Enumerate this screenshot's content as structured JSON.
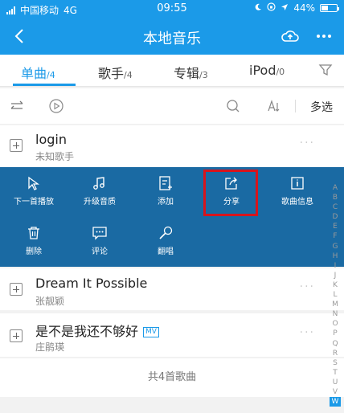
{
  "status": {
    "carrier": "中国移动",
    "network": "4G",
    "time": "09:55",
    "battery": "44%",
    "battery_level": 0.44
  },
  "nav": {
    "title": "本地音乐"
  },
  "tabs": [
    {
      "label": "单曲",
      "count": "/4"
    },
    {
      "label": "歌手",
      "count": "/4"
    },
    {
      "label": "专辑",
      "count": "/3"
    },
    {
      "label": "iPod",
      "count": "/0"
    }
  ],
  "toolbar": {
    "multi_select": "多选"
  },
  "songs": [
    {
      "name": "login",
      "artist": "未知歌手"
    },
    {
      "name": "Dream It Possible",
      "artist": "张靓颖"
    },
    {
      "name": "是不是我还不够好",
      "artist": "庄鹃瑛",
      "badge": "MV"
    }
  ],
  "actions": {
    "next": "下一首播放",
    "upgrade": "升级音质",
    "add": "添加",
    "share": "分享",
    "info": "歌曲信息",
    "delete": "删除",
    "comment": "评论",
    "cover": "翻唱"
  },
  "footer": "共4首歌曲",
  "index_letters": [
    "A",
    "B",
    "C",
    "D",
    "E",
    "F",
    "G",
    "H",
    "I",
    "J",
    "K",
    "L",
    "M",
    "N",
    "O",
    "P",
    "Q",
    "R",
    "S",
    "T",
    "U",
    "V",
    "W"
  ],
  "active_letter": "W"
}
